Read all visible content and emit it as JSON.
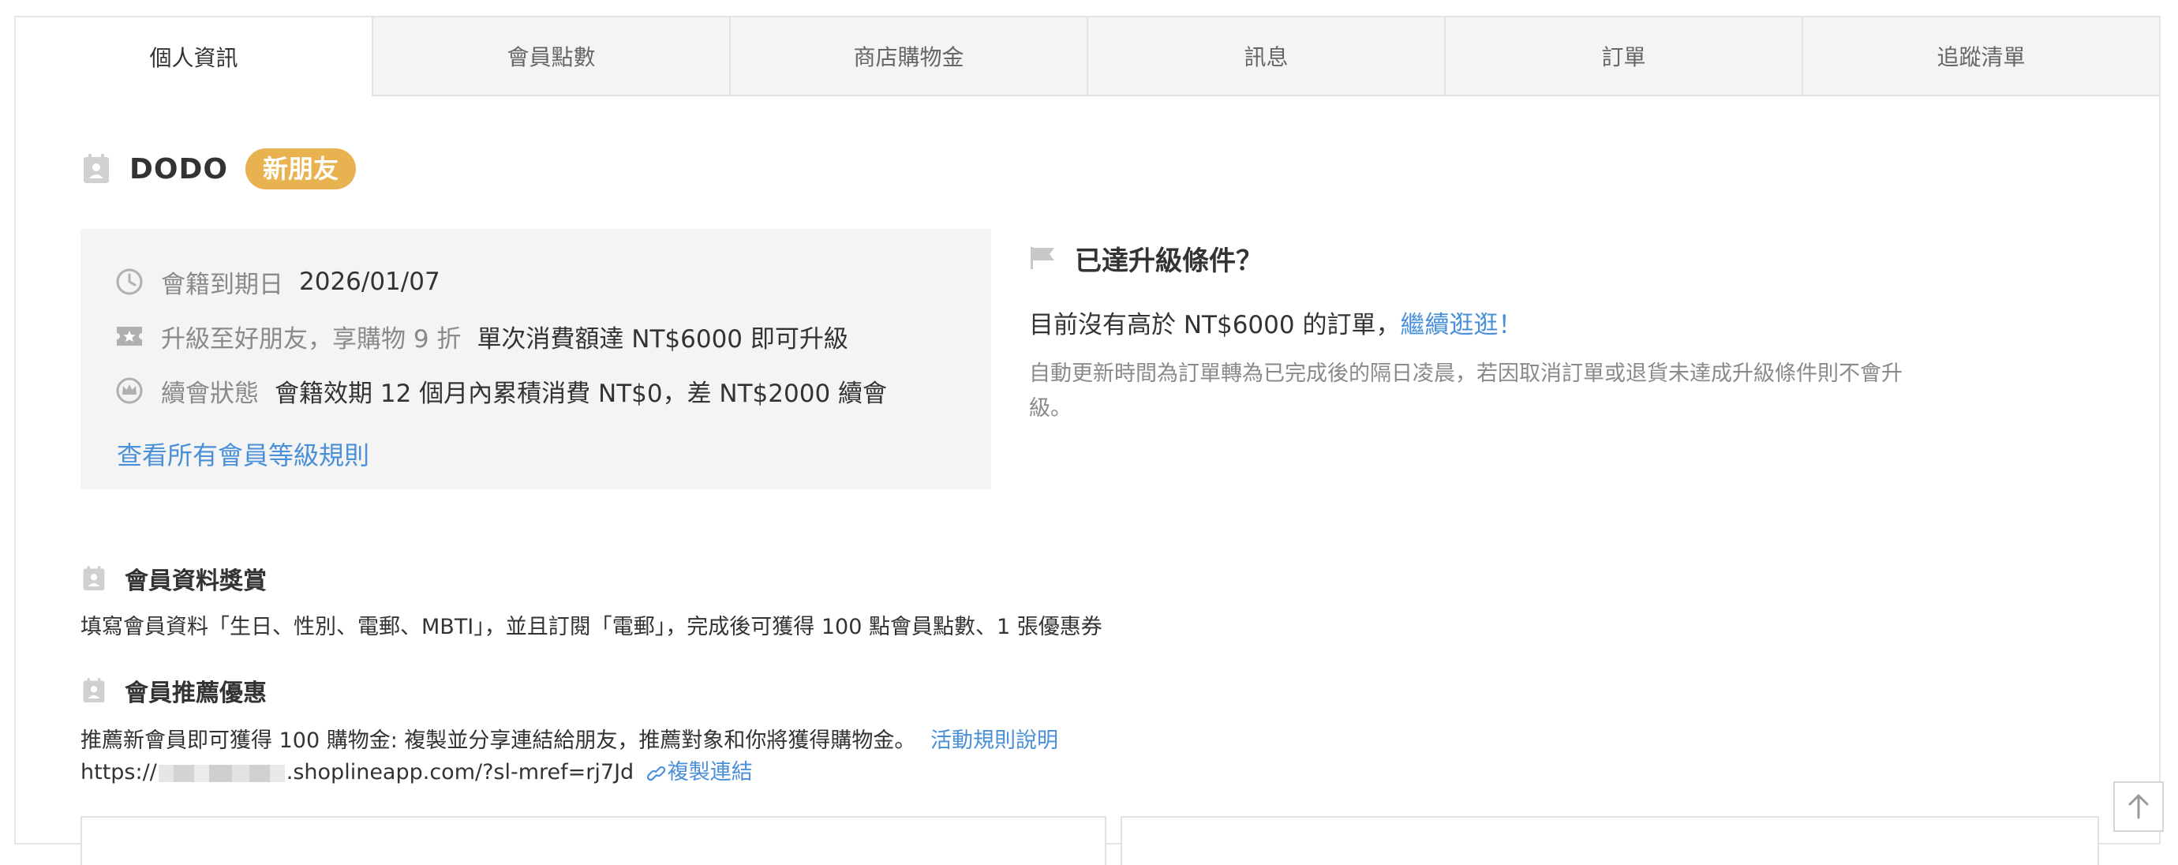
{
  "tabs": [
    {
      "label": "個人資訊",
      "active": true
    },
    {
      "label": "會員點數",
      "active": false
    },
    {
      "label": "商店購物金",
      "active": false
    },
    {
      "label": "訊息",
      "active": false
    },
    {
      "label": "訂單",
      "active": false
    },
    {
      "label": "追蹤清單",
      "active": false
    }
  ],
  "profile": {
    "icon": "member-card-icon",
    "name": "DODO",
    "tier_badge": "新朋友",
    "badge_color": "#e7b24f"
  },
  "membership": {
    "expiry_label": "會籍到期日",
    "expiry_value": "2026/01/07",
    "upgrade_label": "升級至好朋友，享購物 9 折",
    "upgrade_value": "單次消費額達 NT$6000 即可升級",
    "renewal_label": "續會狀態",
    "renewal_value": "會籍效期 12 個月內累積消費 NT$0，差 NT$2000 續會",
    "rules_link": "查看所有會員等級規則"
  },
  "upgrade_condition": {
    "title": "已達升級條件？",
    "message": "目前沒有高於 NT$6000 的訂單，",
    "shop_link": "繼續逛逛！",
    "note": "自動更新時間為訂單轉為已完成後的隔日凌晨，若因取消訂單或退貨未達成升級條件則不會升級。"
  },
  "profile_reward": {
    "title": "會員資料獎賞",
    "text": "填寫會員資料「生日、性別、電郵、MBTI」，並且訂閱「電郵」，完成後可獲得 100 點會員點數、1 張優惠券"
  },
  "referral": {
    "title": "會員推薦優惠",
    "text": "推薦新會員即可獲得 100 購物金: 複製並分享連結給朋友，推薦對象和你將獲得購物金。",
    "rules_link": "活動規則說明",
    "url_prefix": "https://",
    "url_suffix": ".shoplineapp.com/?sl-mref=rj7Jd",
    "copy_link": "複製連結"
  },
  "colors": {
    "link": "#4a90d9",
    "panel_bg": "#f4f4f4",
    "muted_text": "#8a8a8a"
  }
}
